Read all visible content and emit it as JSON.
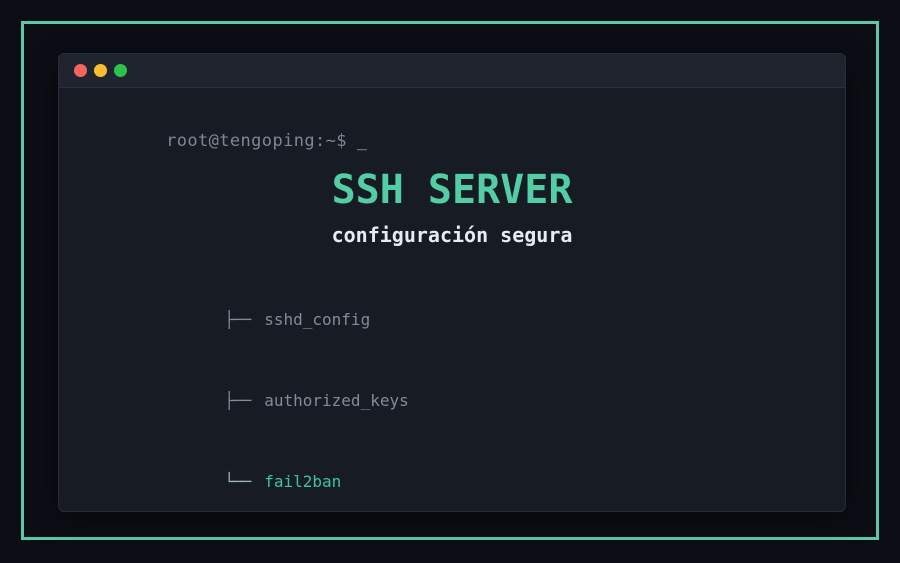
{
  "window": {
    "controls": [
      {
        "name": "close",
        "color": "#f5655b"
      },
      {
        "name": "minimize",
        "color": "#f9bd2e"
      },
      {
        "name": "maximize",
        "color": "#2dc148"
      }
    ]
  },
  "terminal": {
    "prompt": "root@tengoping:~$",
    "cursor": "_"
  },
  "hero": {
    "title": "SSH SERVER",
    "subtitle": "configuración segura"
  },
  "tree": {
    "items": [
      {
        "branch": "├──",
        "label": "sshd_config",
        "highlighted": false
      },
      {
        "branch": "├──",
        "label": "authorized_keys",
        "highlighted": false
      },
      {
        "branch": "└──",
        "label": "fail2ban",
        "highlighted": true
      }
    ]
  },
  "colors": {
    "accent": "#52cda4",
    "frame_border": "#5ec7a6",
    "muted_text": "#7e8694",
    "subtitle_text": "#e9ebee",
    "highlight_text": "#3cc3a2",
    "terminal_bg": "#171b24",
    "titlebar_bg": "#20242e",
    "page_bg": "#0b0e15"
  }
}
